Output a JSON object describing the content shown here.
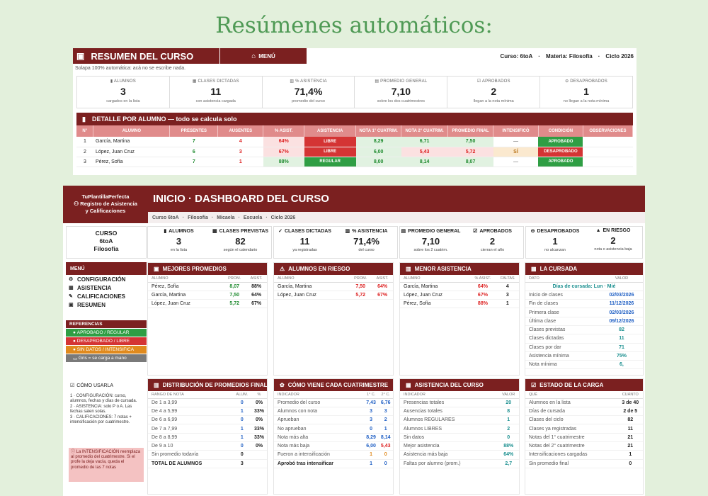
{
  "hero_title": "Resúmenes automáticos:",
  "resumen": {
    "title": "RESUMEN DEL CURSO",
    "menu_label": "MENÚ",
    "meta": {
      "curso": "Curso: 6toA",
      "materia": "Materia: Filosofía",
      "ciclo": "Ciclo 2026",
      "sep": "·"
    },
    "note": "Solapa 100% automática: acá no se escribe nada.",
    "kpis": [
      {
        "label": "ALUMNOS",
        "value": "3",
        "sub": "cargados en la lista"
      },
      {
        "label": "CLASES DICTADAS",
        "value": "11",
        "sub": "con asistencia cargada"
      },
      {
        "label": "% ASISTENCIA",
        "value": "71,4%",
        "sub": "promedio del curso"
      },
      {
        "label": "PROMEDIO GENERAL",
        "value": "7,10",
        "sub": "sobre los dos cuatrimestres"
      },
      {
        "label": "APROBADOS",
        "value": "2",
        "sub": "llegan a la nota mínima"
      },
      {
        "label": "DESAPROBADOS",
        "value": "1",
        "sub": "no llegan a la nota mínima"
      }
    ],
    "detail_title": "DETALLE POR ALUMNO",
    "detail_dash": "—",
    "detail_sub": "todo se calcula solo",
    "columns": [
      "N°",
      "ALUMNO",
      "PRESENTES",
      "AUSENTES",
      "% ASIST.",
      "ASISTENCIA",
      "NOTA 1° CUATRIM.",
      "NOTA 2° CUATRIM.",
      "PROMEDIO FINAL",
      "INTENSIFICÓ",
      "CONDICIÓN",
      "OBSERVACIONES"
    ],
    "rows": [
      {
        "n": "1",
        "alumno": "García, Martina",
        "presentes": "7",
        "ausentes": "4",
        "pct": "64%",
        "asistencia": "LIBRE",
        "n1": "8,29",
        "n2": "6,71",
        "prom": "7,50",
        "intens": "—",
        "condicion": "APROBADO",
        "obs": ""
      },
      {
        "n": "2",
        "alumno": "López, Juan Cruz",
        "presentes": "6",
        "ausentes": "3",
        "pct": "67%",
        "asistencia": "LIBRE",
        "n1": "6,00",
        "n2": "5,43",
        "prom": "5,72",
        "intens": "SÍ",
        "condicion": "DESAPROBADO",
        "obs": ""
      },
      {
        "n": "3",
        "alumno": "Pérez, Sofía",
        "presentes": "7",
        "ausentes": "1",
        "pct": "88%",
        "asistencia": "REGULAR",
        "n1": "8,00",
        "n2": "8,14",
        "prom": "8,07",
        "intens": "—",
        "condicion": "APROBADO",
        "obs": ""
      }
    ]
  },
  "dashboard": {
    "brand": [
      "TuPlantillaPerfecta",
      "Registro de Asistencia",
      "y Calificaciones"
    ],
    "title": "INICIO  ·  DASHBOARD DEL CURSO",
    "crumbs": [
      "Curso 6toA",
      "·",
      "Filosofía",
      "·",
      "Micaela",
      "·",
      "Escuela",
      "·",
      "Ciclo 2026"
    ],
    "curso_box": [
      "CURSO",
      "6toA",
      "Filosofía"
    ],
    "kpis": [
      {
        "label": "ALUMNOS",
        "value": "3",
        "sub": "en la lista"
      },
      {
        "label": "CLASES PREVISTAS",
        "value": "82",
        "sub": "según el calendario"
      },
      {
        "label": "CLASES DICTADAS",
        "value": "11",
        "sub": "ya registradas"
      },
      {
        "label": "% ASISTENCIA",
        "value": "71,4%",
        "sub": "del curso"
      },
      {
        "label": "PROMEDIO GENERAL",
        "value": "7,10",
        "sub": "sobre los 2 cuatrim."
      },
      {
        "label": "APROBADOS",
        "value": "2",
        "sub": "cierran el año"
      },
      {
        "label": "DESAPROBADOS",
        "value": "1",
        "sub": "no alcanzan"
      },
      {
        "label": "EN RIESGO",
        "value": "2",
        "sub": "nota o asistencia baja"
      }
    ],
    "menu_title": "MENÚ",
    "menu": [
      "CONFIGURACIÓN",
      "ASISTENCIA",
      "CALIFICACIONES",
      "RESUMEN"
    ],
    "refs_title": "REFERENCIAS",
    "refs": [
      "APROBADO / REGULAR",
      "DESAPROBADO / LIBRE",
      "SIN DATOS / INTENSIFICA",
      "Gris = se carga a mano"
    ],
    "mejores": {
      "title": "MEJORES PROMEDIOS",
      "cols": [
        "ALUMNO",
        "PROM.",
        "ASIST."
      ],
      "rows": [
        [
          "Pérez, Sofía",
          "8,07",
          "88%"
        ],
        [
          "García, Martina",
          "7,50",
          "64%"
        ],
        [
          "López, Juan Cruz",
          "5,72",
          "67%"
        ]
      ]
    },
    "riesgo": {
      "title": "ALUMNOS EN RIESGO",
      "cols": [
        "ALUMNO",
        "PROM.",
        "ASIST."
      ],
      "rows": [
        [
          "García, Martina",
          "7,50",
          "64%"
        ],
        [
          "López, Juan Cruz",
          "5,72",
          "67%"
        ]
      ]
    },
    "menor": {
      "title": "MENOR ASISTENCIA",
      "cols": [
        "ALUMNO",
        "% ASIST.",
        "FALTAS"
      ],
      "rows": [
        [
          "García, Martina",
          "64%",
          "4"
        ],
        [
          "López, Juan Cruz",
          "67%",
          "3"
        ],
        [
          "Pérez, Sofía",
          "88%",
          "1"
        ]
      ]
    },
    "cursada": {
      "title": "LA CURSADA",
      "cols": [
        "DATO",
        "VALOR"
      ],
      "dias_label": "Días de cursada:",
      "dias_value": "Lun · Mié",
      "rows": [
        [
          "Inicio de clases",
          "02/03/2026"
        ],
        [
          "Fin de clases",
          "11/12/2026"
        ],
        [
          "Primera clase",
          "02/03/2026"
        ],
        [
          "Última clase",
          "09/12/2026"
        ],
        [
          "Clases previstas",
          "82"
        ],
        [
          "Clases dictadas",
          "11"
        ],
        [
          "Clases por dar",
          "71"
        ],
        [
          "Asistencia mínima",
          "75%"
        ],
        [
          "Nota mínima",
          "6,"
        ]
      ]
    },
    "usar": {
      "title": "CÓMO USARLA",
      "steps": [
        "1 · CONFIGURACIÓN: curso, alumnos, fechas y días de cursada.",
        "2 · ASISTENCIA: solo P o A. Las fechas salen solas.",
        "3 · CALIFICACIONES: 7 notas + intensificación por cuatrimestre."
      ],
      "warn": "La INTENSIFICACIÓN reemplaza al promedio del cuatrimestre. Si el profe la deja vacía, queda el promedio de las 7 notas"
    },
    "distrib": {
      "title": "DISTRIBUCIÓN DE PROMEDIOS FINALES",
      "cols": [
        "RANGO DE NOTA",
        "ALUM.",
        "%"
      ],
      "rows": [
        [
          "De 1 a 3,99",
          "0",
          "0%"
        ],
        [
          "De 4 a 5,99",
          "1",
          "33%"
        ],
        [
          "De 6 a 6,99",
          "0",
          "0%"
        ],
        [
          "De 7 a 7,99",
          "1",
          "33%"
        ],
        [
          "De 8 a 8,99",
          "1",
          "33%"
        ],
        [
          "De 9 a 10",
          "0",
          "0%"
        ],
        [
          "Sin promedio todavía",
          "0",
          ""
        ],
        [
          "TOTAL DE ALUMNOS",
          "3",
          ""
        ]
      ]
    },
    "cuatri": {
      "title": "CÓMO VIENE CADA CUATRIMESTRE",
      "cols": [
        "INDICADOR",
        "1° C.",
        "2° C."
      ],
      "rows": [
        [
          "Promedio del curso",
          "7,43",
          "6,76"
        ],
        [
          "Alumnos con nota",
          "3",
          "3"
        ],
        [
          "Aprueban",
          "3",
          "2"
        ],
        [
          "No aprueban",
          "0",
          "1"
        ],
        [
          "Nota más alta",
          "8,29",
          "8,14"
        ],
        [
          "Nota más baja",
          "6,00",
          "5,43"
        ],
        [
          "Fueron a intensificación",
          "1",
          "0"
        ],
        [
          "Aprobó tras intensificar",
          "1",
          "0"
        ]
      ]
    },
    "asist": {
      "title": "ASISTENCIA DEL CURSO",
      "cols": [
        "INDICADOR",
        "VALOR"
      ],
      "rows": [
        [
          "Presencias totales",
          "20"
        ],
        [
          "Ausencias totales",
          "8"
        ],
        [
          "Alumnos REGULARES",
          "1"
        ],
        [
          "Alumnos LIBRES",
          "2"
        ],
        [
          "Sin datos",
          "0"
        ],
        [
          "Mejor asistencia",
          "88%"
        ],
        [
          "Asistencia más baja",
          "64%"
        ],
        [
          "Faltas por alumno (prom.)",
          "2,7"
        ]
      ]
    },
    "carga": {
      "title": "ESTADO DE LA CARGA",
      "cols": [
        "QUÉ",
        "CUÁNTO"
      ],
      "rows": [
        [
          "Alumnos en la lista",
          "3 de 40"
        ],
        [
          "Días de cursada",
          "2 de 5"
        ],
        [
          "Clases del ciclo",
          "82"
        ],
        [
          "Clases ya registradas",
          "11"
        ],
        [
          "Notas del 1° cuatrimestre",
          "21"
        ],
        [
          "Notas del 2° cuatrimestre",
          "21"
        ],
        [
          "Intensificaciones cargadas",
          "1"
        ],
        [
          "Sin promedio final",
          "0"
        ]
      ]
    }
  }
}
